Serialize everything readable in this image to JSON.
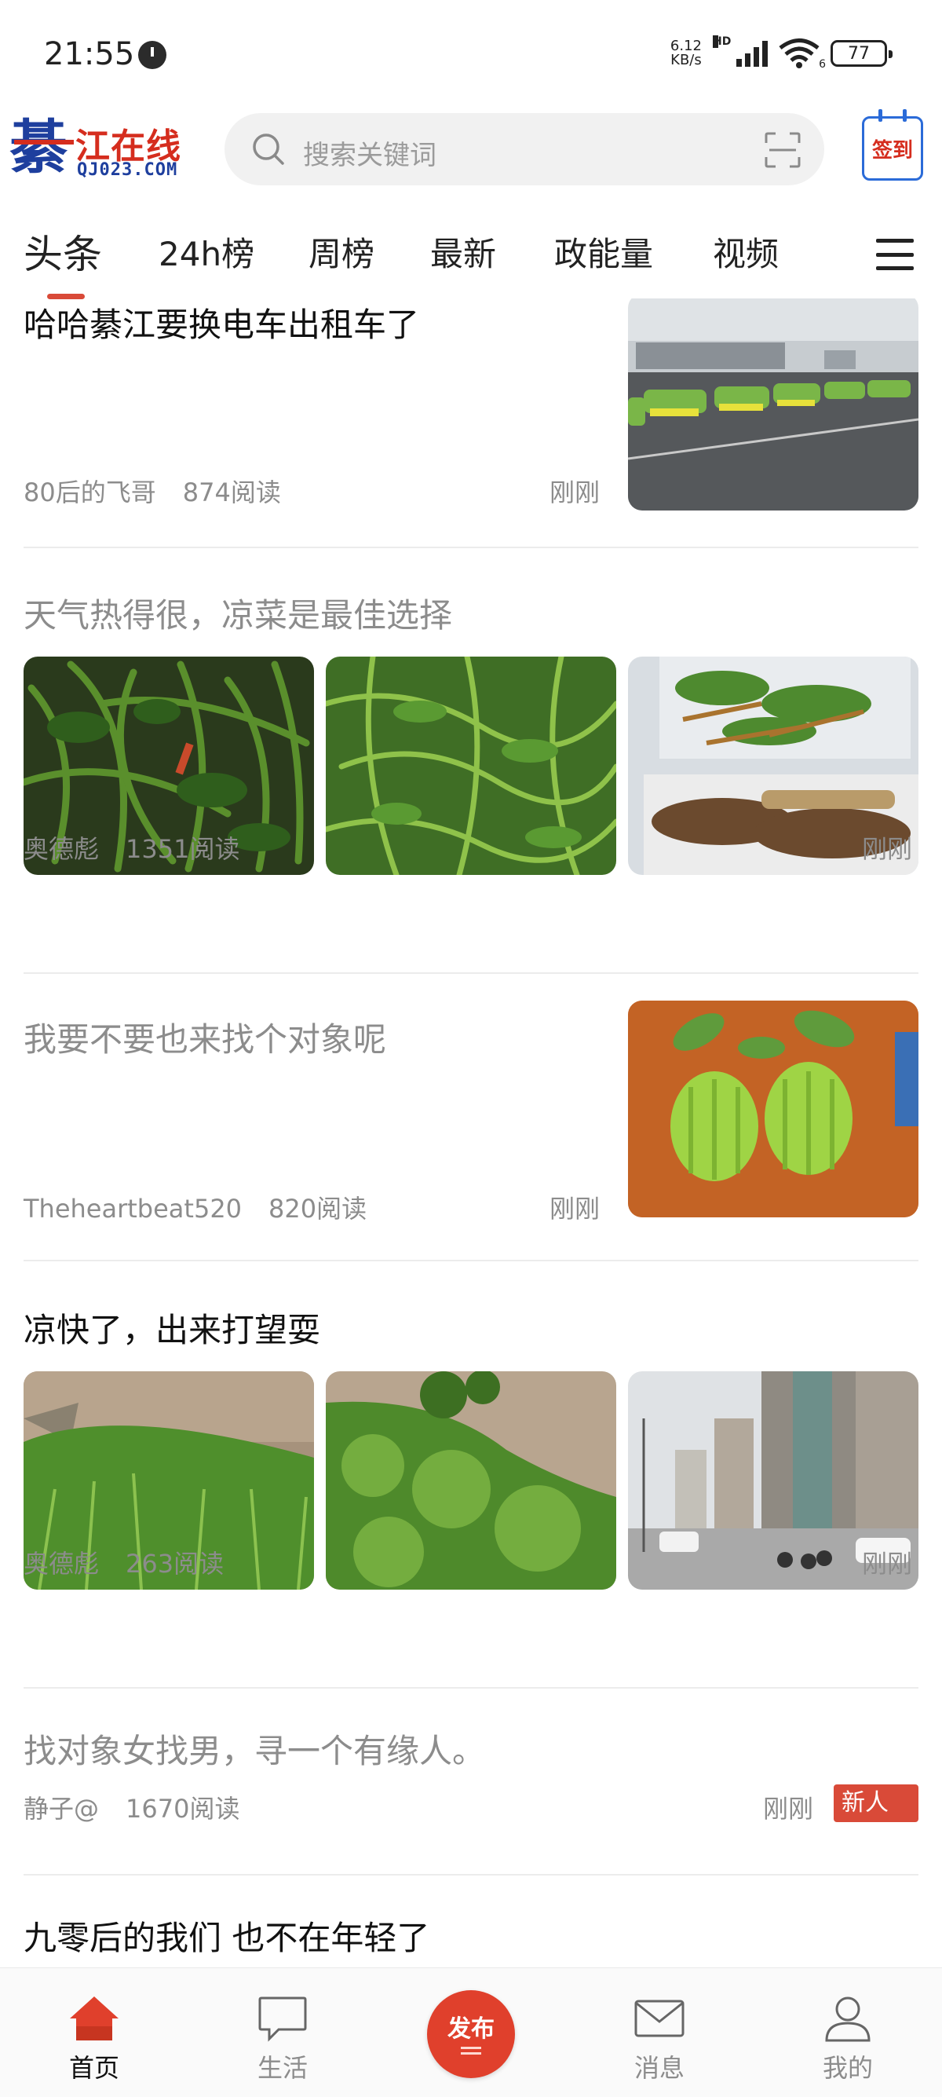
{
  "status_bar": {
    "time": "21:55",
    "net_speed_value": "6.12",
    "net_speed_unit": "KB/s",
    "signal_label": "HD",
    "wifi_label": "6",
    "battery": "77"
  },
  "header": {
    "logo_char": "綦",
    "logo_title": "江在线",
    "logo_url": "QJ023.COM",
    "search_placeholder": "搜索关键词",
    "checkin_label": "签到"
  },
  "tabs": [
    "头条",
    "24h榜",
    "周榜",
    "最新",
    "政能量",
    "视频"
  ],
  "active_tab": 0,
  "posts": [
    {
      "title": "哈哈綦江要换电车出租车了",
      "author": "80后的飞哥",
      "reads": "874阅读",
      "time": "刚刚",
      "read": false,
      "images": [
        "taxi-parking-lot-photo"
      ]
    },
    {
      "title": "天气热得很，凉菜是最佳选择",
      "author": "奥德彪",
      "reads": "1351阅读",
      "time": "刚刚",
      "read": true,
      "images": [
        "stir-fried-greens-photo",
        "fresh-greens-photo",
        "cold-dish-box-photo"
      ]
    },
    {
      "title": "我要不要也来找个对象呢",
      "author": "Theheartbeat520",
      "reads": "820阅读",
      "time": "刚刚",
      "read": true,
      "images": [
        "fingered-citron-photo"
      ]
    },
    {
      "title": "凉快了，出来打望耍",
      "author": "奥德彪",
      "reads": "263阅读",
      "time": "刚刚",
      "read": false,
      "images": [
        "riverbank-grass-photo",
        "green-shrubs-photo",
        "street-scene-photo"
      ]
    },
    {
      "title": "找对象女找男，寻一个有缘人。",
      "author": "静子@",
      "reads": "1670阅读",
      "time": "刚刚",
      "badge": "新人帖",
      "read": true,
      "images": []
    },
    {
      "title": "九零后的我们 也不在年轻了",
      "read": false
    }
  ],
  "bottom_nav": {
    "home": "首页",
    "life": "生活",
    "publish": "发布",
    "messages": "消息",
    "mine": "我的"
  },
  "colors": {
    "accent": "#e0402c",
    "logo_blue": "#1e3f9e",
    "meta_gray": "#8c8c8c"
  }
}
